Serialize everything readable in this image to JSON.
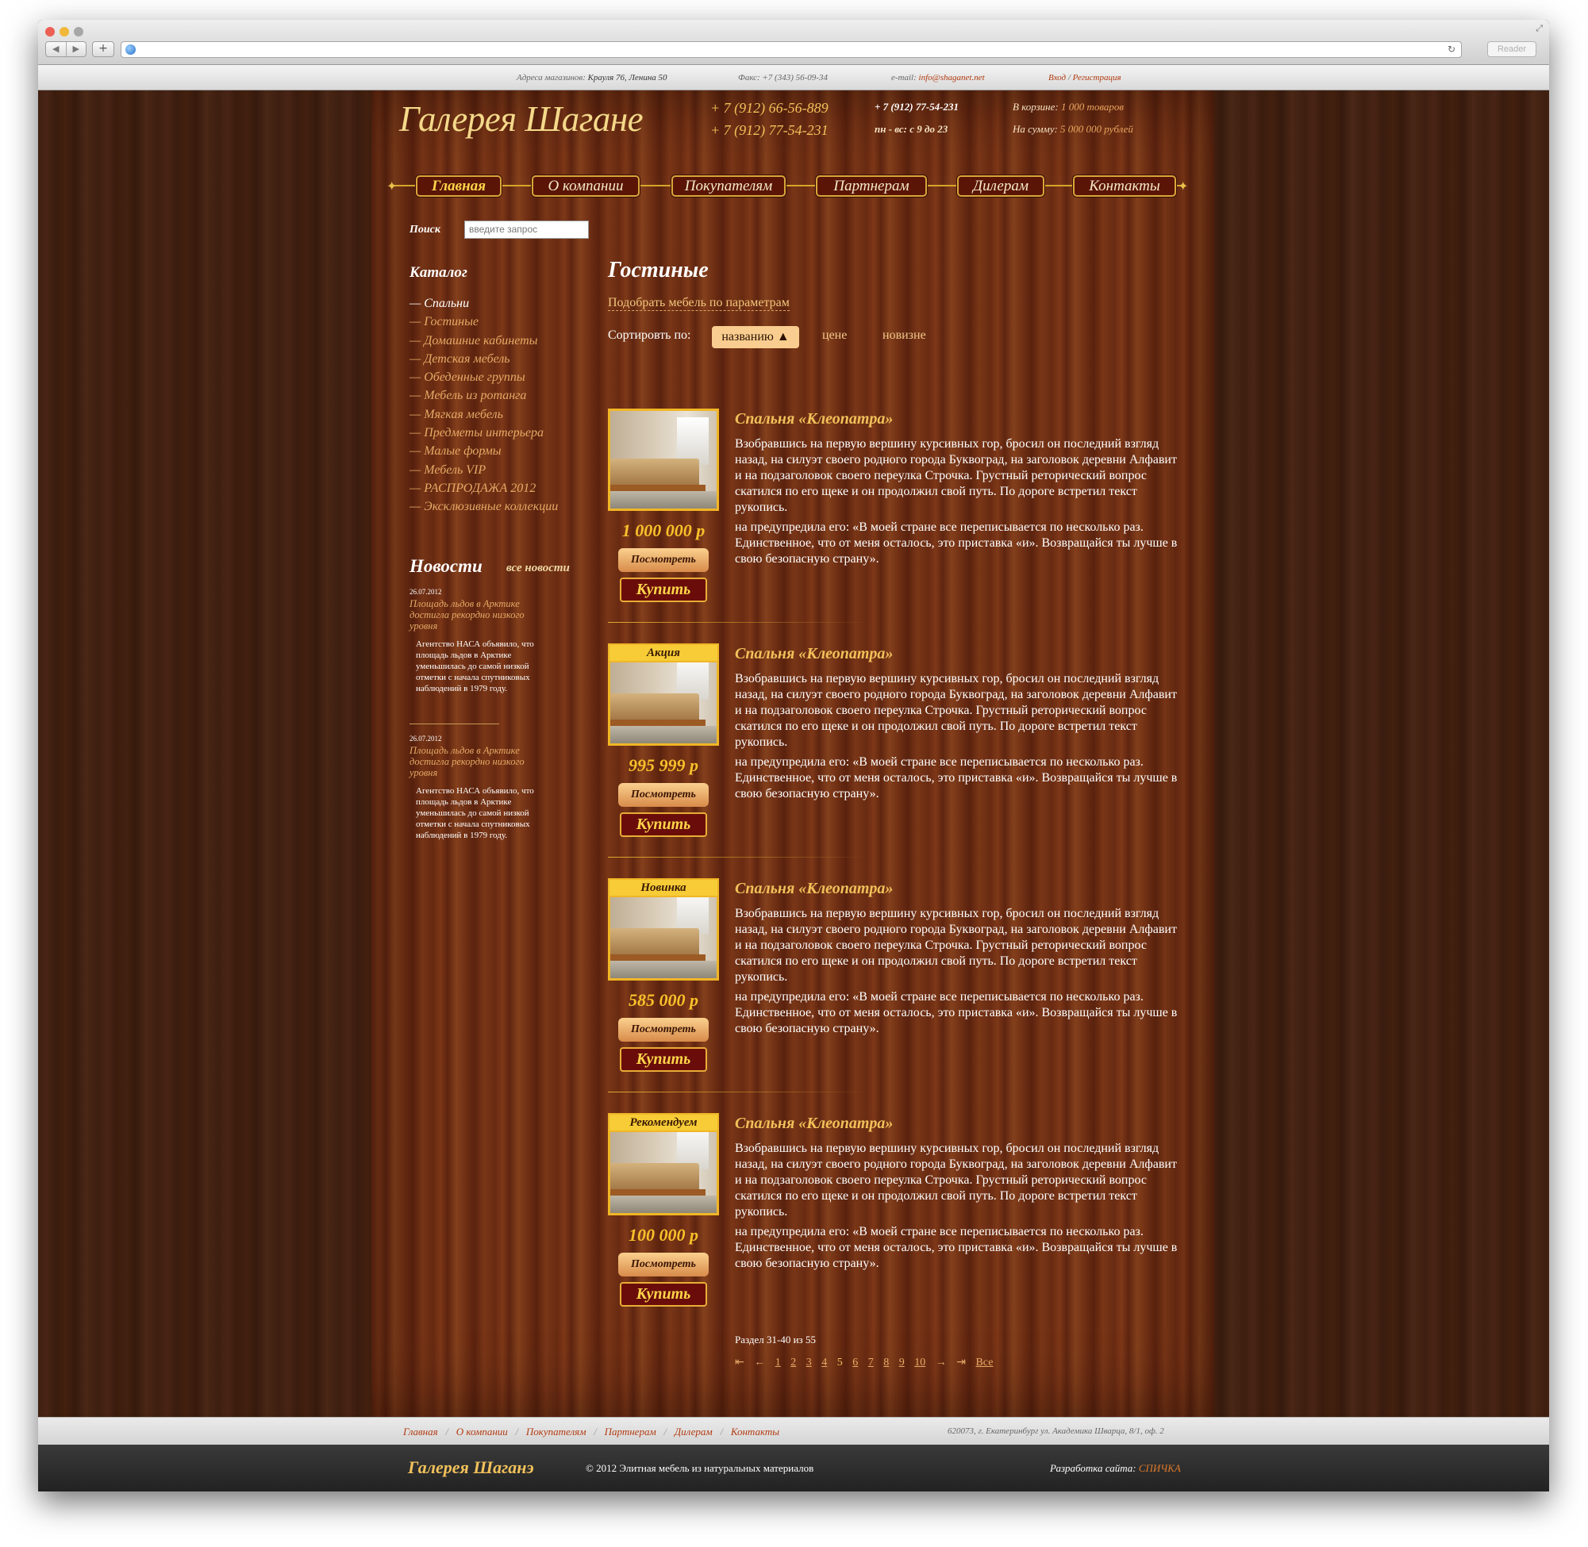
{
  "browser": {
    "reader_label": "Reader",
    "back_glyph": "◀",
    "forward_glyph": "▶",
    "newtab_glyph": "+",
    "reload_glyph": "↻",
    "resize_glyph": "⤢",
    "traffic_colors": [
      "#ec5f55",
      "#f0b73a",
      "#a7a7a7"
    ]
  },
  "topbar": {
    "address_label": "Адреса магазинов:",
    "address_value": "Крауля 76, Ленина 50",
    "fax": "Факс: +7 (343) 56-09-34",
    "email_label": "e-mail:",
    "email_value": "info@shaganet.net",
    "login": "Вход",
    "separator": "/",
    "register": "Регистрация"
  },
  "header": {
    "logo": "Галерея Шагане",
    "phone1": "+ 7 (912) 66-56-889",
    "phone2": "+ 7 (912) 77-54-231",
    "phone3": "+ 7 (912) 77-54-231",
    "hours": "пн - вс: с 9 до 23",
    "cart_label": "В корзине:",
    "cart_value": "1 000 товаров",
    "sum_label": "На сумму:",
    "sum_value": "5 000 000 рублей"
  },
  "menu": {
    "items": [
      "Главная",
      "О компании",
      "Покупателям",
      "Партнерам",
      "Дилерам",
      "Контакты"
    ],
    "end_glyph": "✦"
  },
  "search": {
    "label": "Поиск",
    "placeholder": "введите запрос"
  },
  "catalog": {
    "title": "Каталог",
    "items": [
      "— Спальни",
      "— Гостиные",
      "— Домашние кабинеты",
      "— Детская мебель",
      "— Обеденные группы",
      "— Мебель из ротанга",
      "— Мягкая мебель",
      "— Предметы интерьера",
      "— Малые формы",
      "— Мебель VIP",
      "— РАСПРОДАЖА 2012",
      "— Эксклюзивные коллекции"
    ]
  },
  "news": {
    "title": "Новости",
    "all_link": "все новости",
    "items": [
      {
        "date": "26.07.2012",
        "headline": "Площадь льдов в Арктике достигла рекордно низкого уровня",
        "text": "Агентство НАСА объявило, что площадь льдов в Арктике уменьшилась до самой низкой отметки с начала спутниковых наблюдений в 1979 году."
      },
      {
        "date": "26.07.2012",
        "headline": "Площадь льдов в Арктике достигла рекордно низкого уровня",
        "text": "Агентство НАСА объявило, что площадь льдов в Арктике уменьшилась до самой низкой отметки с начала спутниковых наблюдений в 1979 году."
      }
    ]
  },
  "main": {
    "title": "Гостиные",
    "filter_link": "Подобрать мебель по параметрам",
    "sort_label": "Сортировть по:",
    "sort_active": "названию ▲",
    "sort_price": "цене",
    "sort_new": "новизне"
  },
  "products": [
    {
      "badge": "",
      "name": "Спальня «Клеопатра»",
      "price": "1 000 000 р",
      "view_label": "Посмотреть",
      "buy_label": "Купить",
      "desc1": "Взобравшись на первую вершину курсивных гор, бросил он последний взгляд назад, на силуэт своего родного города Буквоград, на заголовок деревни Алфавит и на подзаголовок своего переулка Строчка. Грустный реторический вопрос скатился по его щеке и он продолжил свой путь. По дороге встретил текст рукопись.",
      "desc2": "на предупредила его: «В моей стране все переписывается по несколько раз. Единственное, что от меня осталось, это приставка «и». Возвращайся ты лучше в свою безопасную страну»."
    },
    {
      "badge": "Акция",
      "name": "Спальня «Клеопатра»",
      "price": "995 999 р",
      "view_label": "Посмотреть",
      "buy_label": "Купить",
      "desc1": "Взобравшись на первую вершину курсивных гор, бросил он последний взгляд назад, на силуэт своего родного города Буквоград, на заголовок деревни Алфавит и на подзаголовок своего переулка Строчка. Грустный реторический вопрос скатился по его щеке и он продолжил свой путь. По дороге встретил текст рукопись.",
      "desc2": "на предупредила его: «В моей стране все переписывается по несколько раз. Единственное, что от меня осталось, это приставка «и». Возвращайся ты лучше в свою безопасную страну»."
    },
    {
      "badge": "Новинка",
      "name": "Спальня «Клеопатра»",
      "price": "585 000 р",
      "view_label": "Посмотреть",
      "buy_label": "Купить",
      "desc1": "Взобравшись на первую вершину курсивных гор, бросил он последний взгляд назад, на силуэт своего родного города Буквоград, на заголовок деревни Алфавит и на подзаголовок своего переулка Строчка. Грустный реторический вопрос скатился по его щеке и он продолжил свой путь. По дороге встретил текст рукопись.",
      "desc2": "на предупредила его: «В моей стране все переписывается по несколько раз. Единственное, что от меня осталось, это приставка «и». Возвращайся ты лучше в свою безопасную страну»."
    },
    {
      "badge": "Рекомендуем",
      "name": "Спальня «Клеопатра»",
      "price": "100 000 р",
      "view_label": "Посмотреть",
      "buy_label": "Купить",
      "desc1": "Взобравшись на первую вершину курсивных гор, бросил он последний взгляд назад, на силуэт своего родного города Буквоград, на заголовок деревни Алфавит и на подзаголовок своего переулка Строчка. Грустный реторический вопрос скатился по его щеке и он продолжил свой путь. По дороге встретил текст рукопись.",
      "desc2": "на предупредила его: «В моей стране все переписывается по несколько раз. Единственное, что от меня осталось, это приставка «и». Возвращайся ты лучше в свою безопасную страну»."
    }
  ],
  "pagination": {
    "info": "Раздел 31-40 из 55",
    "first": "⇤",
    "prev": "←",
    "pages": [
      "1",
      "2",
      "3",
      "4",
      "5",
      "6",
      "7",
      "8",
      "9",
      "10"
    ],
    "current": "5",
    "next": "→",
    "last": "⇥",
    "all": "Все"
  },
  "footer": {
    "links": [
      "Главная",
      "О компании",
      "Покупателям",
      "Партнерам",
      "Дилерам",
      "Контакты"
    ],
    "link_separator": "/",
    "address": "620073, г. Екатеринбург ул. Академика Шварца, 8/1, оф. 2",
    "logo": "Галерея Шаганэ",
    "copyright": "© 2012 Элитная мебель из натуральных материалов",
    "dev_label": "Разработка сайта:",
    "dev_name": "СПИЧКА"
  }
}
